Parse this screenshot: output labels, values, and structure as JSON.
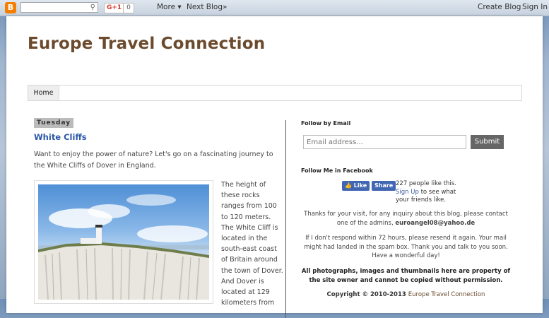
{
  "navbar": {
    "gplus_label": "G+1",
    "gplus_count": "0",
    "more_label": "More ▾",
    "next_blog_label": "Next Blog»",
    "create_blog_label": "Create Blog",
    "sign_in_label": "Sign In"
  },
  "blog": {
    "title": "Europe Travel Connection"
  },
  "tabs": [
    {
      "label": "Home"
    }
  ],
  "post": {
    "date_header": "Tuesday",
    "title": "White Cliffs",
    "intro": "Want to enjoy the power of nature? Let's go on a fascinating journey to the White Cliffs of Dover in England.",
    "side_text": "The height of these rocks ranges from 100 to 120 meters. The White Cliff is located in the south-east coast of Britain around the town of Dover. And Dover is located at 129 kilometers from"
  },
  "sidebar": {
    "follow_email_heading": "Follow by Email",
    "email_placeholder": "Email address...",
    "submit_label": "Submit",
    "facebook_heading": "Follow Me in Facebook",
    "fb_like_label": "Like",
    "fb_share_label": "Share",
    "fb_count_text": "227 people like this.",
    "fb_signup_link": "Sign Up",
    "fb_signup_rest": "to see what your friends like.",
    "thanks_text": "Thanks for your visit, for any inquiry about this blog, please contact one of the admins,",
    "admin_email": "euroangel08@yahoo.de",
    "respond_text": "If I don't respond within 72 hours, please resend it again. Your mail might had landed in the spam box. Thank you and talk to you soon. Have a wonderful day!",
    "rights_text": "All photographs, images and thumbnails here are property of the site owner and cannot be copied without permission.",
    "copyright_prefix": "Copyright © 2010-2013",
    "copyright_site": "Europe Travel Connection"
  },
  "colors": {
    "title_brown": "#6b4a2d",
    "post_title_blue": "#2b57a8",
    "facebook_blue": "#4267b2",
    "blogger_orange": "#f57d00"
  }
}
